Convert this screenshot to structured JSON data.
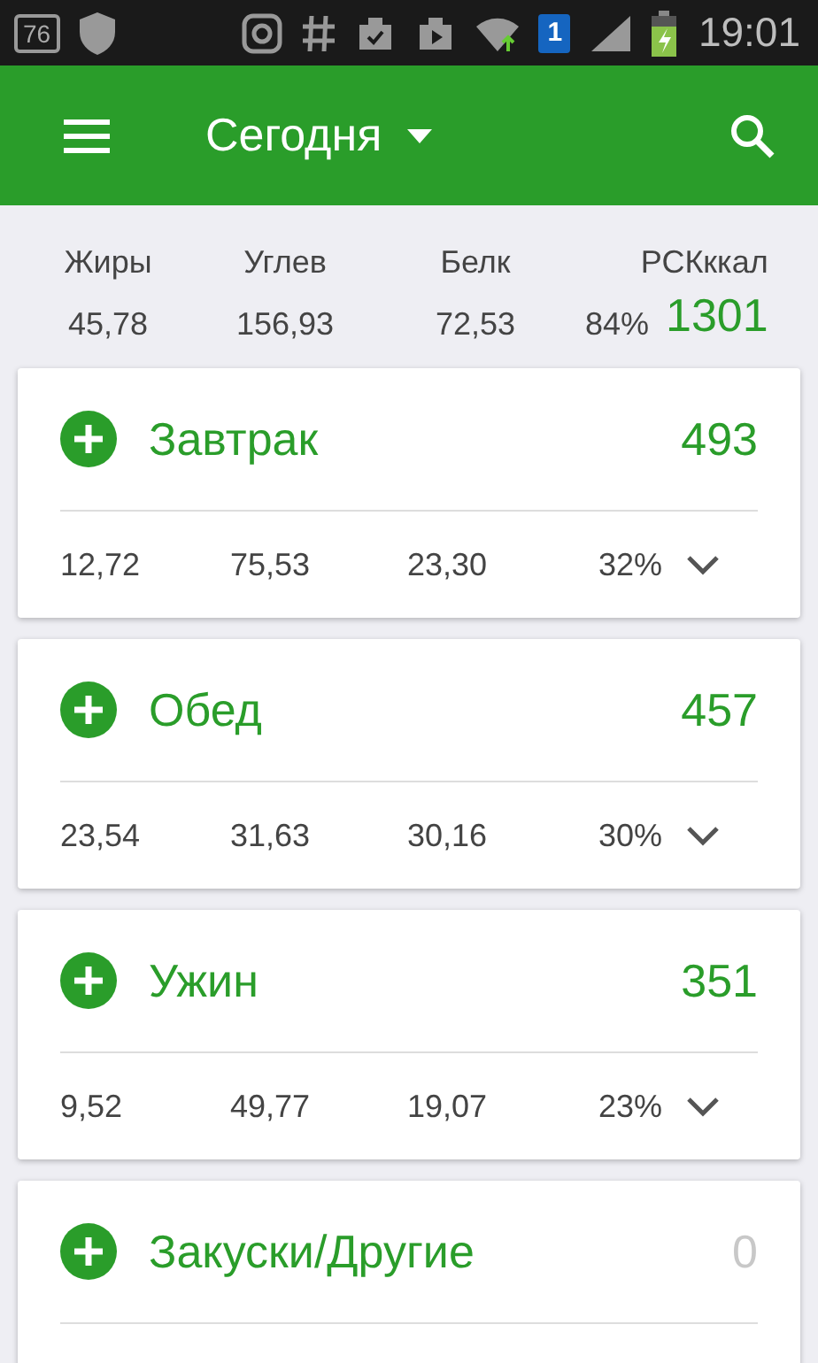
{
  "status_bar": {
    "badge": "76",
    "sim": "1",
    "time": "19:01"
  },
  "app_bar": {
    "title": "Сегодня"
  },
  "summary": {
    "labels": [
      "Жиры",
      "Углев",
      "Белк",
      "РСКккал"
    ],
    "values": [
      "45,78",
      "156,93",
      "72,53",
      "84%"
    ],
    "calories": "1301"
  },
  "meals": [
    {
      "name": "Завтрак",
      "calories": "493",
      "empty": false,
      "values": [
        "12,72",
        "75,53",
        "23,30",
        "32%"
      ]
    },
    {
      "name": "Обед",
      "calories": "457",
      "empty": false,
      "values": [
        "23,54",
        "31,63",
        "30,16",
        "30%"
      ]
    },
    {
      "name": "Ужин",
      "calories": "351",
      "empty": false,
      "values": [
        "9,52",
        "49,77",
        "19,07",
        "23%"
      ]
    },
    {
      "name": "Закуски/Другие",
      "calories": "0",
      "empty": true
    }
  ]
}
